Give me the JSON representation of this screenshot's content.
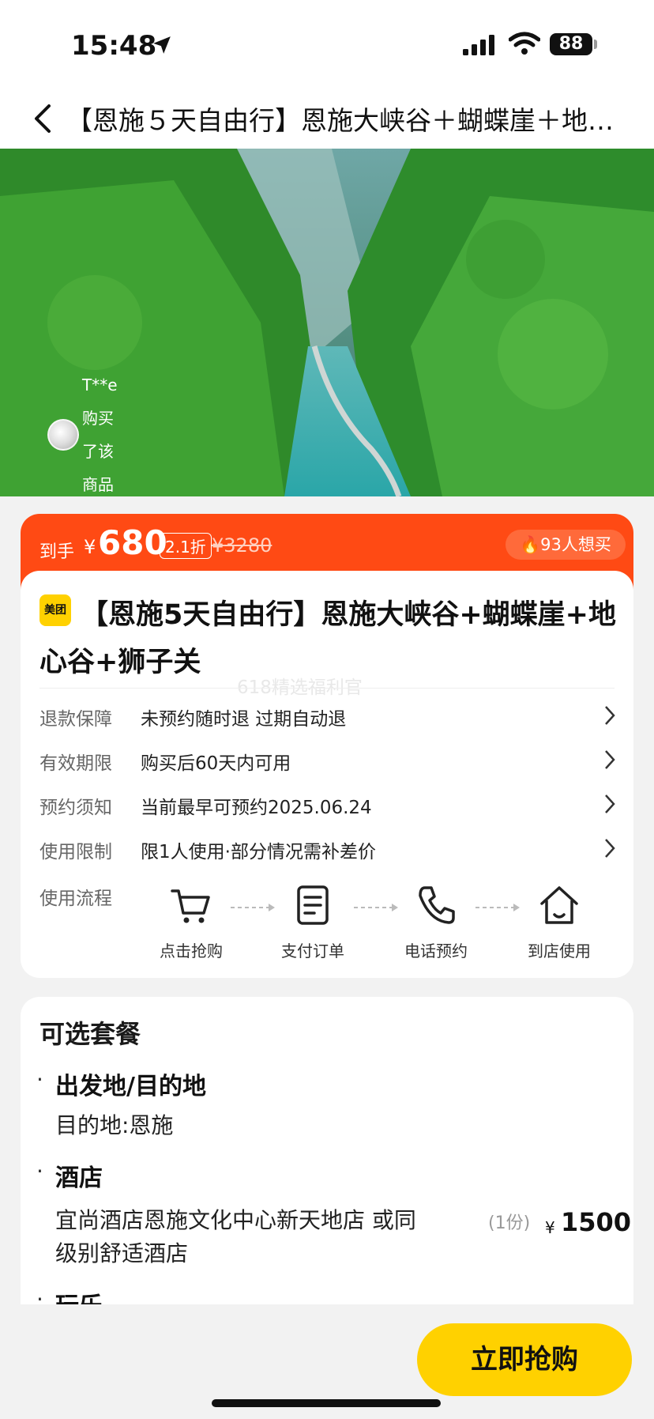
{
  "status_bar": {
    "time": "15:48",
    "battery": "88"
  },
  "nav": {
    "title": "【恩施５天自由行】恩施大峡谷＋蝴蝶崖＋地心…"
  },
  "hero": {
    "buyer_text": "T**e 购买了该商品"
  },
  "price": {
    "label": "到手",
    "currency": "¥",
    "value": "680",
    "discount": "2.1折",
    "original": "3280",
    "want": "93人想买"
  },
  "product": {
    "brand": "美团",
    "title": "【恩施5天自由行】恩施大峡谷+蝴蝶崖+地心谷+狮子关",
    "watermark": "618精选福利官"
  },
  "info_rows": [
    {
      "key": "退款保障",
      "value": "未预约随时退 过期自动退"
    },
    {
      "key": "有效期限",
      "value": "购买后60天内可用"
    },
    {
      "key": "预约须知",
      "value": "当前最早可预约2025.06.24"
    },
    {
      "key": "使用限制",
      "value": "限1人使用·部分情况需补差价"
    }
  ],
  "flow": {
    "label": "使用流程",
    "steps": [
      {
        "label": "点击抢购",
        "icon": "cart-icon"
      },
      {
        "label": "支付订单",
        "icon": "document-icon"
      },
      {
        "label": "电话预约",
        "icon": "phone-icon"
      },
      {
        "label": "到店使用",
        "icon": "home-icon"
      }
    ]
  },
  "package": {
    "heading": "可选套餐",
    "section1": "出发地/目的地",
    "destination": "目的地:恩施",
    "section2": "酒店",
    "hotel_line1": "宜尚酒店恩施文化中心新天地店 或同",
    "hotel_line2": "级别舒适酒店",
    "qty": "(1份)",
    "currency": "¥",
    "amount": "1500",
    "section3": "玩乐"
  },
  "buy_button": "立即抢购"
}
